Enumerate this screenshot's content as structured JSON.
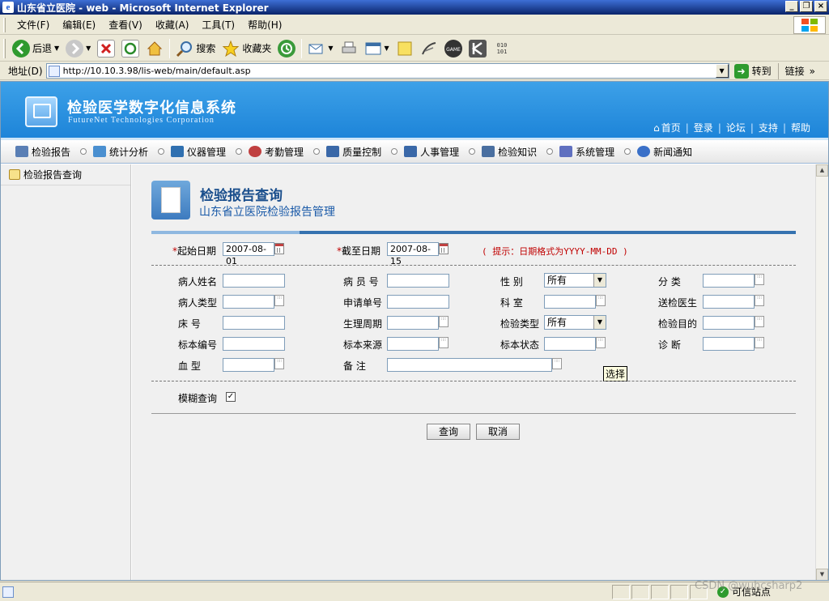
{
  "window": {
    "title": "山东省立医院 - web - Microsoft Internet Explorer",
    "icon_text": "e",
    "controls": {
      "minimize": "_",
      "restore": "❐",
      "close": "×"
    }
  },
  "menubar": [
    "文件(F)",
    "编辑(E)",
    "查看(V)",
    "收藏(A)",
    "工具(T)",
    "帮助(H)"
  ],
  "toolbar": {
    "back": "后退",
    "search": "搜索",
    "favorites": "收藏夹"
  },
  "address": {
    "label": "地址(D)",
    "url": "http://10.10.3.98/lis-web/main/default.asp",
    "go": "转到",
    "links": "链接",
    "links_arrow": "»"
  },
  "site": {
    "title": "检验医学数字化信息系统",
    "subtitle": "FutureNet Technologies Corporation",
    "links": [
      "首页",
      "登录",
      "论坛",
      "支持",
      "帮助"
    ],
    "home_icon": "⌂",
    "link_separator": "|"
  },
  "nav": {
    "items": [
      "检验报告",
      "统计分析",
      "仪器管理",
      "考勤管理",
      "质量控制",
      "人事管理",
      "检验知识",
      "系统管理",
      "新闻通知"
    ],
    "icon_colors": [
      "#5a7fb5",
      "#4a8fd0",
      "#3070b0",
      "#c04040",
      "#3a68a8",
      "#3a68a8",
      "#4a6fa0",
      "#6070c0",
      "#3a70c8"
    ]
  },
  "sidebar": {
    "items": [
      {
        "label": "检验报告查询"
      }
    ]
  },
  "page": {
    "title": "检验报告查询",
    "subtitle": "山东省立医院检验报告管理"
  },
  "form": {
    "required_mark": "*",
    "start_date_label": "起始日期",
    "start_date": "2007-08-01",
    "end_date_label": "截至日期",
    "end_date": "2007-08-15",
    "hint": "( 提示：日期格式为YYYY-MM-DD )",
    "fields": {
      "patient_name": "病人姓名",
      "patient_no": "病 员 号",
      "gender": "性    别",
      "category": "分    类",
      "patient_type": "病人类型",
      "request_no": "申请单号",
      "department": "科    室",
      "sending_doctor": "送检医生",
      "bed_no": "床    号",
      "physio_cycle": "生理周期",
      "test_type": "检验类型",
      "test_purpose": "检验目的",
      "specimen_no": "标本编号",
      "specimen_source": "标本来源",
      "specimen_status": "标本状态",
      "diagnosis": "诊    断",
      "blood_type": "血    型",
      "remarks": "备    注"
    },
    "gender_value": "所有",
    "test_type_value": "所有",
    "select_arrow": "▼",
    "picker_glyph": "∷∷",
    "tooltip": "选择",
    "fuzzy_label": "模糊查询",
    "fuzzy_checked": "✓",
    "query_button": "查询",
    "cancel_button": "取消"
  },
  "scrollbar": {
    "up": "▲",
    "down": "▼"
  },
  "status": {
    "zone_label": "可信站点",
    "zone_icon": "✓",
    "watermark": "CSDN @wuhcsharp2"
  }
}
